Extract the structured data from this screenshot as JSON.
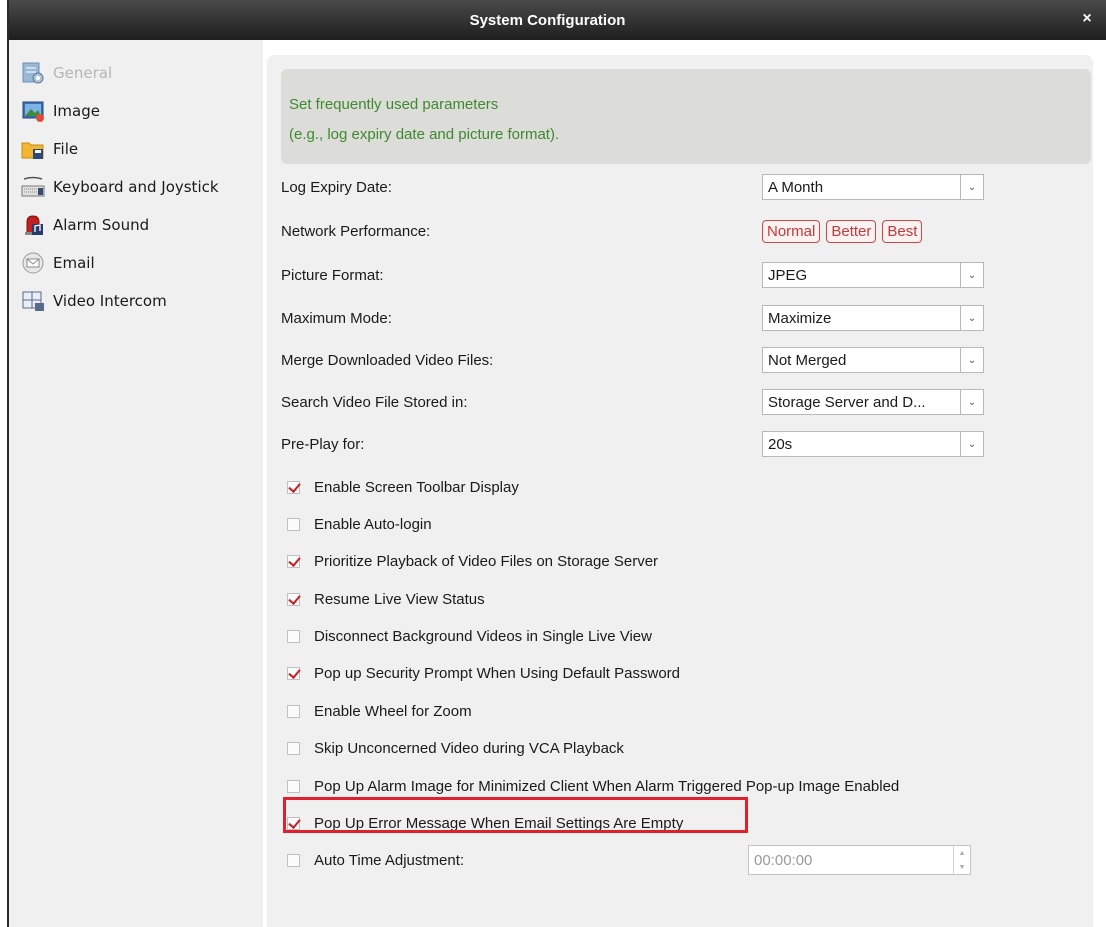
{
  "window": {
    "title": "System Configuration",
    "close_glyph": "×"
  },
  "sidebar": {
    "items": [
      {
        "label": "General",
        "icon": "general-settings-icon",
        "selected": true
      },
      {
        "label": "Image",
        "icon": "image-icon"
      },
      {
        "label": "File",
        "icon": "folder-icon"
      },
      {
        "label": "Keyboard and Joystick",
        "icon": "keyboard-icon"
      },
      {
        "label": "Alarm Sound",
        "icon": "alarm-sound-icon"
      },
      {
        "label": "Email",
        "icon": "email-icon"
      },
      {
        "label": "Video Intercom",
        "icon": "video-intercom-icon"
      }
    ]
  },
  "banner": {
    "line1": "Set frequently used parameters",
    "line2": "(e.g., log expiry date and picture format)."
  },
  "settings": {
    "log_expiry": {
      "label": "Log Expiry Date:",
      "value": "A Month"
    },
    "network": {
      "label": "Network Performance:",
      "options": [
        "Normal",
        "Better",
        "Best"
      ]
    },
    "picture_format": {
      "label": "Picture Format:",
      "value": "JPEG"
    },
    "maximum_mode": {
      "label": "Maximum Mode:",
      "value": "Maximize"
    },
    "merge_files": {
      "label": "Merge Downloaded Video Files:",
      "value": "Not Merged"
    },
    "search_stored": {
      "label": "Search Video File Stored in:",
      "value": "Storage Server and D..."
    },
    "pre_play": {
      "label": "Pre-Play for:",
      "value": "20s"
    }
  },
  "checkboxes": [
    {
      "label": "Enable Screen Toolbar Display",
      "checked": true
    },
    {
      "label": "Enable Auto-login",
      "checked": false
    },
    {
      "label": "Prioritize Playback of Video Files on Storage Server",
      "checked": true
    },
    {
      "label": "Resume Live View Status",
      "checked": true
    },
    {
      "label": "Disconnect Background Videos in Single Live View",
      "checked": false
    },
    {
      "label": "Pop up Security Prompt When Using Default Password",
      "checked": true
    },
    {
      "label": "Enable Wheel for Zoom",
      "checked": false
    },
    {
      "label": "Skip Unconcerned Video during VCA Playback",
      "checked": false
    },
    {
      "label": "Pop Up Alarm Image for Minimized Client When Alarm Triggered Pop-up Image Enabled",
      "checked": false
    },
    {
      "label": "Pop Up Error Message When Email Settings Are Empty",
      "checked": true
    },
    {
      "label": "Auto Time Adjustment:",
      "checked": false
    }
  ],
  "auto_time": {
    "value": "00:00:00"
  },
  "colors": {
    "checkmark": "#c81e1e",
    "highlight": "#e0202a",
    "banner_text": "#3d8a30"
  }
}
